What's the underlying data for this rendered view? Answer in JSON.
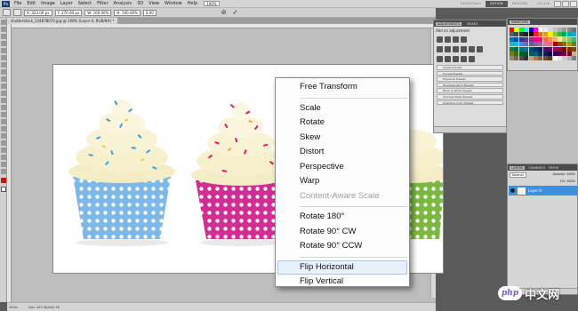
{
  "menubar": {
    "logo": "Ps",
    "items": [
      "File",
      "Edit",
      "Image",
      "Layer",
      "Select",
      "Filter",
      "Analysis",
      "3D",
      "View",
      "Window",
      "Help"
    ],
    "zoom": "100%",
    "workspaces": [
      "ESSENTIALS",
      "DESIGN",
      "PAINTING"
    ],
    "active_workspace": "DESIGN",
    "cs_live": "CS Live"
  },
  "options_bar": {
    "x": "X: 323.00 px",
    "y": "Y: 270.00 px",
    "w": "W: 100.00%",
    "h": "H: 100.00%",
    "angle": "0.00",
    "cancel": "⊘",
    "commit": "✓"
  },
  "document": {
    "tab_title": "shutterstock_134878072.jpg @ 100% (Layer 0, RGB/8#) *",
    "status_zoom": "100%",
    "status_doc": "Doc: 402.3K/402.3K"
  },
  "context_menu": {
    "items": [
      {
        "label": "Free Transform",
        "disabled": false
      },
      {
        "sep": true
      },
      {
        "label": "Scale",
        "disabled": false
      },
      {
        "label": "Rotate",
        "disabled": false
      },
      {
        "label": "Skew",
        "disabled": false
      },
      {
        "label": "Distort",
        "disabled": false
      },
      {
        "label": "Perspective",
        "disabled": false
      },
      {
        "label": "Warp",
        "disabled": false
      },
      {
        "label": "Content-Aware Scale",
        "disabled": true
      },
      {
        "sep": true
      },
      {
        "label": "Rotate 180°",
        "disabled": false
      },
      {
        "label": "Rotate 90° CW",
        "disabled": false
      },
      {
        "label": "Rotate 90° CCW",
        "disabled": false
      },
      {
        "sep": true
      },
      {
        "label": "Flip Horizontal",
        "disabled": false,
        "highlighted": true
      },
      {
        "label": "Flip Vertical",
        "disabled": false
      }
    ]
  },
  "adjustments_panel": {
    "tabs": [
      "ADJUSTMENTS",
      "MASKS"
    ],
    "title": "Add an adjustment",
    "presets": [
      "Levels Presets",
      "Curves Presets",
      "Exposure Presets",
      "Hue/Saturation Presets",
      "Black & White Presets",
      "Channel Mixer Presets",
      "Selective Color Presets"
    ]
  },
  "swatches_panel": {
    "tab": "SWATCHES",
    "colors": [
      "#ff0000",
      "#ffff00",
      "#00ff00",
      "#00ffff",
      "#0000ff",
      "#ff00ff",
      "#ffffff",
      "#ebebeb",
      "#d6d6d6",
      "#c2c2c2",
      "#adadad",
      "#999999",
      "#858585",
      "#707070",
      "#5c5c5c",
      "#474747",
      "#333333",
      "#1f1f1f",
      "#000000",
      "#ee1d24",
      "#f16522",
      "#f7941d",
      "#fff200",
      "#8dc63f",
      "#39b54a",
      "#00a651",
      "#00a99d",
      "#00aeef",
      "#0072bc",
      "#0054a6",
      "#2e3192",
      "#662d91",
      "#92278f",
      "#ec008c",
      "#ed145b",
      "#f26c4f",
      "#f68e56",
      "#fbaf5c",
      "#fff568",
      "#acd373",
      "#7cc576",
      "#3cb878",
      "#1abbb4",
      "#00bff3",
      "#448ccb",
      "#5574b9",
      "#605ca8",
      "#8560a8",
      "#a763a8",
      "#f06ea9",
      "#f26d7d",
      "#9e0b0f",
      "#a0410d",
      "#a36209",
      "#aba000",
      "#598527",
      "#1a7b30",
      "#007236",
      "#00746b",
      "#0076a3",
      "#004a80",
      "#003471",
      "#1b1464",
      "#440e62",
      "#630460",
      "#9e005d",
      "#9e0039",
      "#790000",
      "#7b2e00",
      "#7d4900",
      "#827b00",
      "#406618",
      "#005e20",
      "#005826",
      "#005952",
      "#005b7f",
      "#003663",
      "#002157",
      "#0d004c",
      "#32004b",
      "#4b0049",
      "#7b0046",
      "#7a0026",
      "#c7b299",
      "#998675",
      "#736357",
      "#534741",
      "#37302d",
      "#c69c6d",
      "#a67c52",
      "#8c6239",
      "#754c24",
      "#603913",
      "#ffffff",
      "#e6e6e6",
      "#cccccc",
      "#b3b3b3",
      "#808080"
    ]
  },
  "layers_panel": {
    "tabs": [
      "LAYERS",
      "CHANNELS",
      "PATHS"
    ],
    "blend_mode": "Normal",
    "opacity": "Opacity: 100%",
    "fill": "Fill: 100%",
    "layer_name": "Layer 0"
  },
  "watermark": {
    "php": "php",
    "cn": "中文网"
  },
  "colors": {
    "liner_blue": "#79b5e6",
    "liner_pink": "#d12a91",
    "liner_green": "#7cb83e",
    "frosting": "#f6efc9",
    "foreground": "#cc1111"
  }
}
